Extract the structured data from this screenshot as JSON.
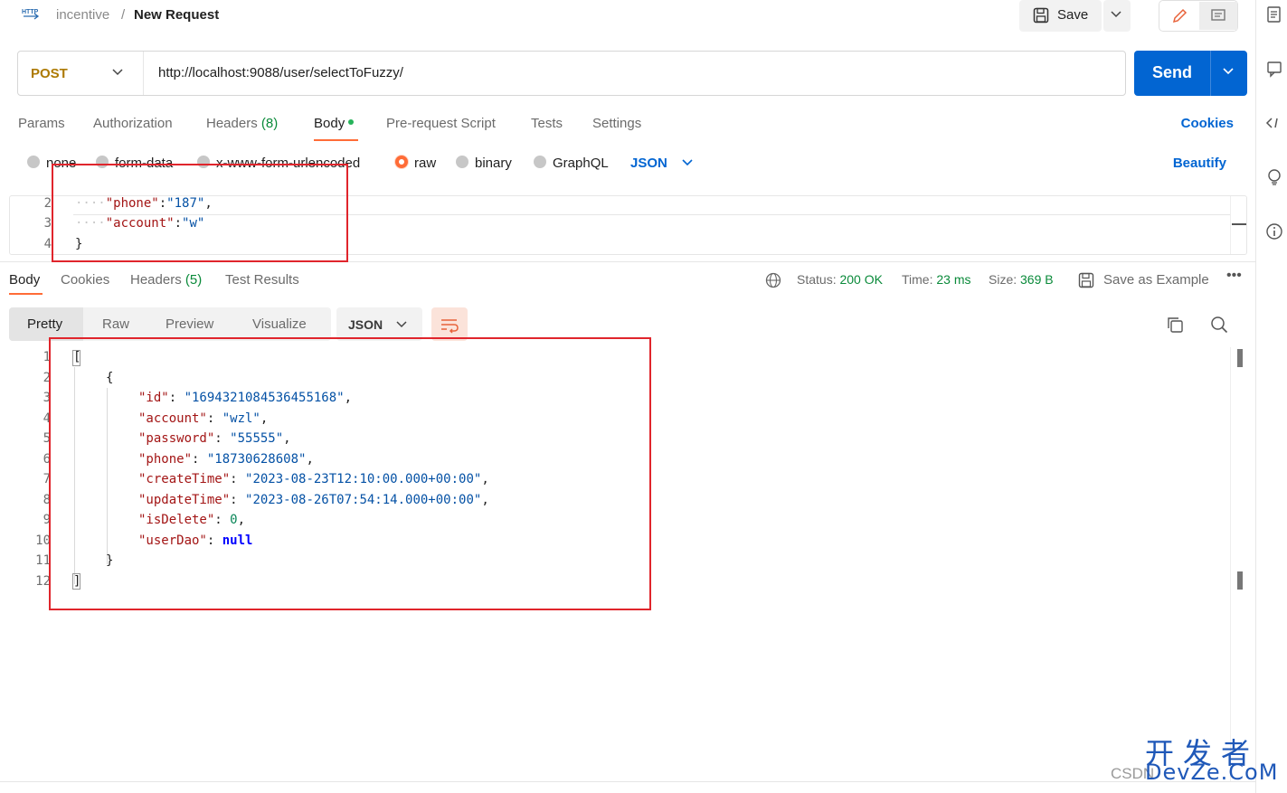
{
  "breadcrumb": {
    "collection": "incentive",
    "separator": "/",
    "request_name": "New Request"
  },
  "toolbar": {
    "save_label": "Save"
  },
  "request": {
    "method": "POST",
    "url": "http://localhost:9088/user/selectToFuzzy/",
    "send_label": "Send"
  },
  "request_tabs": {
    "params": "Params",
    "authorization": "Authorization",
    "headers": "Headers",
    "headers_count": "(8)",
    "body": "Body",
    "prerequest": "Pre-request Script",
    "tests": "Tests",
    "settings": "Settings",
    "cookies": "Cookies"
  },
  "body_types": {
    "none": "none",
    "form_data": "form-data",
    "urlencoded": "x-www-form-urlencoded",
    "raw": "raw",
    "binary": "binary",
    "graphql": "GraphQL",
    "format": "JSON",
    "beautify": "Beautify",
    "selected": "raw"
  },
  "request_body": {
    "lines": [
      {
        "num": "2",
        "key": "\"phone\"",
        "value": "\"187\"",
        "trail": ","
      },
      {
        "num": "3",
        "key": "\"account\"",
        "value": "\"w\"",
        "trail": ""
      },
      {
        "num": "4",
        "text": "}"
      }
    ]
  },
  "response_tabs": {
    "body": "Body",
    "cookies": "Cookies",
    "headers": "Headers",
    "headers_count": "(5)",
    "test_results": "Test Results"
  },
  "response_status": {
    "status_label": "Status:",
    "status_value": "200 OK",
    "time_label": "Time:",
    "time_value": "23 ms",
    "size_label": "Size:",
    "size_value": "369 B",
    "save_example": "Save as Example",
    "more": "•••"
  },
  "response_view": {
    "pretty": "Pretty",
    "raw": "Raw",
    "preview": "Preview",
    "visualize": "Visualize",
    "format": "JSON"
  },
  "response_body": {
    "line_numbers": [
      "1",
      "2",
      "3",
      "4",
      "5",
      "6",
      "7",
      "8",
      "9",
      "10",
      "11",
      "12"
    ],
    "open_bracket": "[",
    "open_brace": "{",
    "fields": [
      {
        "key": "\"id\"",
        "value": "\"1694321084536455168\"",
        "type": "string",
        "trail": ","
      },
      {
        "key": "\"account\"",
        "value": "\"wzl\"",
        "type": "string",
        "trail": ","
      },
      {
        "key": "\"password\"",
        "value": "\"55555\"",
        "type": "string",
        "trail": ","
      },
      {
        "key": "\"phone\"",
        "value": "\"18730628608\"",
        "type": "string",
        "trail": ","
      },
      {
        "key": "\"createTime\"",
        "value": "\"2023-08-23T12:10:00.000+00:00\"",
        "type": "string",
        "trail": ","
      },
      {
        "key": "\"updateTime\"",
        "value": "\"2023-08-26T07:54:14.000+00:00\"",
        "type": "string",
        "trail": ","
      },
      {
        "key": "\"isDelete\"",
        "value": "0",
        "type": "number",
        "trail": ","
      },
      {
        "key": "\"userDao\"",
        "value": "null",
        "type": "keyword",
        "trail": ""
      }
    ],
    "close_brace": "}",
    "close_bracket": "]"
  },
  "colors": {
    "accent": "#ff6c37",
    "send_blue": "#0265d2",
    "status_green": "#0a8a3a",
    "annotation_red": "#e0252c"
  },
  "icons": {
    "http": "http-icon",
    "save": "floppy-icon",
    "edit": "pencil-icon",
    "docs": "comment-icon",
    "globe": "globe-icon",
    "copy": "copy-icon",
    "search": "search-icon",
    "wrap": "wrap-lines-icon"
  },
  "watermark": {
    "csdn": "CSDN",
    "line1": "开发者",
    "line2": "DevZe.CoM"
  }
}
